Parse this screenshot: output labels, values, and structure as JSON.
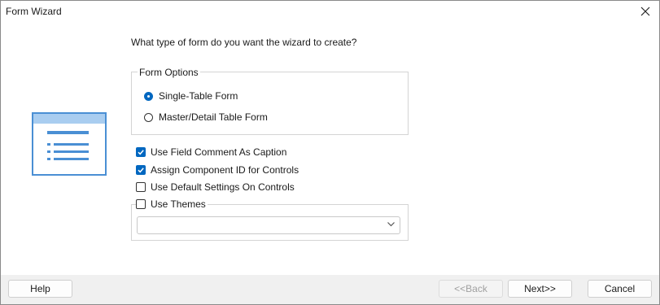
{
  "window": {
    "title": "Form Wizard"
  },
  "prompt": "What type of form do you want the wizard to create?",
  "form_options": {
    "legend": "Form Options",
    "options": [
      {
        "label": "Single-Table Form",
        "selected": true
      },
      {
        "label": "Master/Detail Table Form",
        "selected": false
      }
    ]
  },
  "checkboxes": [
    {
      "label": "Use Field Comment As Caption",
      "checked": true
    },
    {
      "label": "Assign Component ID for Controls",
      "checked": true
    },
    {
      "label": "Use Default Settings On Controls",
      "checked": false
    }
  ],
  "themes": {
    "label": "Use Themes",
    "checked": false,
    "selected_value": ""
  },
  "buttons": {
    "help": "Help",
    "back": "<<Back",
    "back_enabled": false,
    "next": "Next>>",
    "cancel": "Cancel"
  },
  "colors": {
    "accent": "#0067c0",
    "icon_blue": "#4a8fd4",
    "icon_light": "#a9cdf0",
    "footer_bg": "#f0f0f0"
  },
  "icons": {
    "close": "close-icon",
    "wizard": "form-wizard-icon",
    "dropdown": "chevron-down-icon"
  }
}
